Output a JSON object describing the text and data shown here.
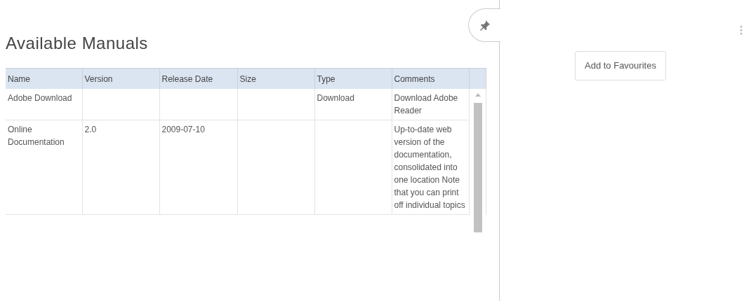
{
  "title": "Available Manuals",
  "table": {
    "columns": [
      "Name",
      "Version",
      "Release Date",
      "Size",
      "Type",
      "Comments"
    ],
    "rows": [
      {
        "cells": [
          "Adobe Download",
          "",
          "",
          "",
          "Download",
          "Download Adobe Reader"
        ]
      },
      {
        "cells": [
          "Online Documentation",
          "2.0",
          "2009-07-10",
          "",
          "",
          "Up-to-date web version of the documentation, consolidated into one location Note that you can print off individual topics"
        ]
      }
    ]
  },
  "favourites_button": "Add to Favourites"
}
